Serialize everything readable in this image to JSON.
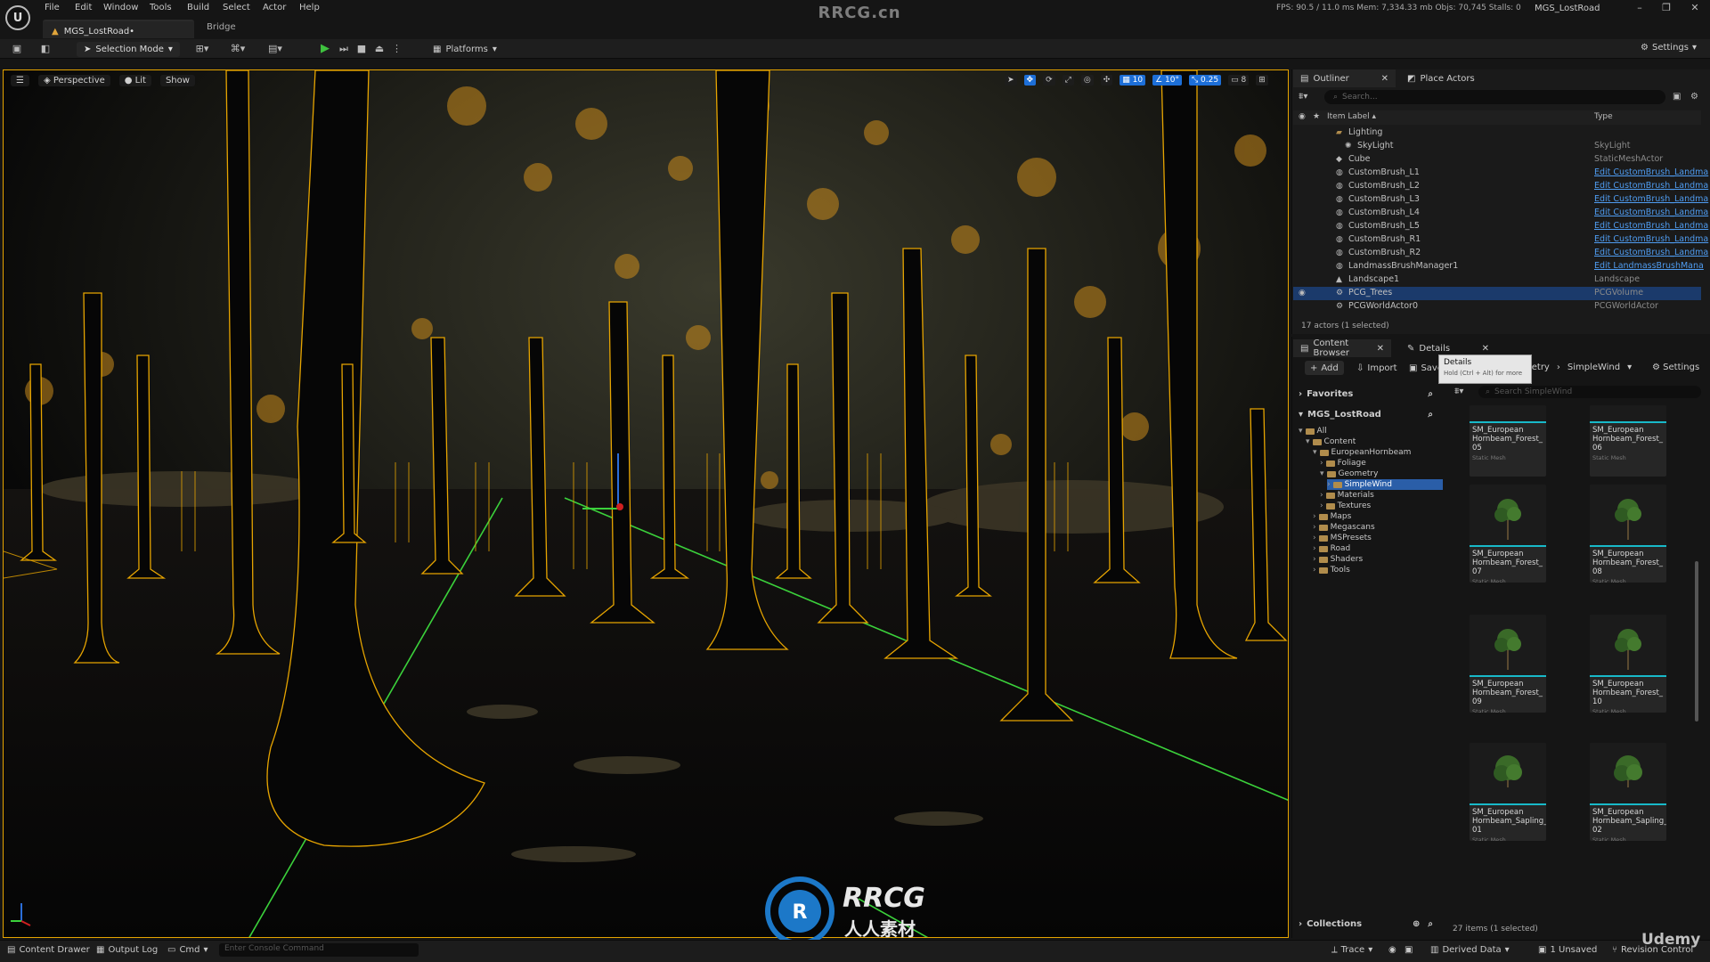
{
  "menu": [
    "File",
    "Edit",
    "Window",
    "Tools",
    "Build",
    "Select",
    "Actor",
    "Help"
  ],
  "window": {
    "center_title": "RRCG.cn",
    "stats": "FPS: 90.5  / 11.0 ms   Mem: 7,334.33 mb   Objs: 70,745   Stalls: 0",
    "project_name": "MGS_LostRoad"
  },
  "tabs": {
    "level": "MGS_LostRoad•",
    "bridge": "Bridge"
  },
  "toolbar": {
    "selection_mode": "Selection Mode",
    "platforms": "Platforms",
    "settings": "Settings"
  },
  "viewport": {
    "perspective": "Perspective",
    "lit": "Lit",
    "show": "Show",
    "grid_snap": "10",
    "rot_snap": "10°",
    "scale_snap": "0.25",
    "camera_speed": "8"
  },
  "outliner": {
    "tab": "Outliner",
    "place_actors_tab": "Place Actors",
    "search_placeholder": "Search...",
    "col_label": "Item Label ▴",
    "col_type": "Type",
    "rows": [
      {
        "label": "Lighting",
        "type": "",
        "link": false,
        "indent": 1,
        "icon": "folder"
      },
      {
        "label": "SkyLight",
        "type": "SkyLight",
        "link": false,
        "indent": 2,
        "icon": "light"
      },
      {
        "label": "Cube",
        "type": "StaticMeshActor",
        "link": false,
        "indent": 1,
        "icon": "mesh"
      },
      {
        "label": "CustomBrush_L1",
        "type": "Edit CustomBrush_Landma",
        "link": true,
        "indent": 1,
        "icon": "actor"
      },
      {
        "label": "CustomBrush_L2",
        "type": "Edit CustomBrush_Landma",
        "link": true,
        "indent": 1,
        "icon": "actor"
      },
      {
        "label": "CustomBrush_L3",
        "type": "Edit CustomBrush_Landma",
        "link": true,
        "indent": 1,
        "icon": "actor"
      },
      {
        "label": "CustomBrush_L4",
        "type": "Edit CustomBrush_Landma",
        "link": true,
        "indent": 1,
        "icon": "actor"
      },
      {
        "label": "CustomBrush_L5",
        "type": "Edit CustomBrush_Landma",
        "link": true,
        "indent": 1,
        "icon": "actor"
      },
      {
        "label": "CustomBrush_R1",
        "type": "Edit CustomBrush_Landma",
        "link": true,
        "indent": 1,
        "icon": "actor"
      },
      {
        "label": "CustomBrush_R2",
        "type": "Edit CustomBrush_Landma",
        "link": true,
        "indent": 1,
        "icon": "actor"
      },
      {
        "label": "LandmassBrushManager1",
        "type": "Edit LandmassBrushMana",
        "link": true,
        "indent": 1,
        "icon": "actor"
      },
      {
        "label": "Landscape1",
        "type": "Landscape",
        "link": false,
        "indent": 1,
        "icon": "landscape"
      },
      {
        "label": "PCG_Trees",
        "type": "PCGVolume",
        "link": false,
        "indent": 1,
        "icon": "pcg",
        "selected": true
      },
      {
        "label": "PCGWorldActor0",
        "type": "PCGWorldActor",
        "link": false,
        "indent": 1,
        "icon": "pcg"
      }
    ],
    "footer": "17 actors (1 selected)"
  },
  "content_browser": {
    "tab": "Content Browser",
    "details_tab": "Details",
    "tooltip_title": "Details",
    "tooltip_sub": "Hold (Ctrl + Alt) for more",
    "add": "Add",
    "import": "Import",
    "save": "Save",
    "breadcrumb": [
      "metry",
      "SimpleWind"
    ],
    "settings": "Settings",
    "favorites": "Favorites",
    "project": "MGS_LostRoad",
    "tree": [
      {
        "name": "All",
        "indent": 0,
        "open": true
      },
      {
        "name": "Content",
        "indent": 1,
        "open": true
      },
      {
        "name": "EuropeanHornbeam",
        "indent": 2,
        "open": true
      },
      {
        "name": "Foliage",
        "indent": 3,
        "open": false
      },
      {
        "name": "Geometry",
        "indent": 3,
        "open": true
      },
      {
        "name": "SimpleWind",
        "indent": 4,
        "open": false,
        "selected": true
      },
      {
        "name": "Materials",
        "indent": 3,
        "open": false
      },
      {
        "name": "Textures",
        "indent": 3,
        "open": false
      },
      {
        "name": "Maps",
        "indent": 2,
        "open": false
      },
      {
        "name": "Megascans",
        "indent": 2,
        "open": false
      },
      {
        "name": "MSPresets",
        "indent": 2,
        "open": false
      },
      {
        "name": "Road",
        "indent": 2,
        "open": false
      },
      {
        "name": "Shaders",
        "indent": 2,
        "open": false
      },
      {
        "name": "Tools",
        "indent": 2,
        "open": false
      }
    ],
    "search_placeholder": "Search SimpleWind",
    "assets": [
      {
        "name": "SM_European\nHornbeam_Forest_\n05",
        "kind": "Static Mesh",
        "thumb": "none"
      },
      {
        "name": "SM_European\nHornbeam_Forest_\n06",
        "kind": "Static Mesh",
        "thumb": "none"
      },
      {
        "name": "SM_European\nHornbeam_Forest_\n07",
        "kind": "Static Mesh",
        "thumb": "tree"
      },
      {
        "name": "SM_European\nHornbeam_Forest_\n08",
        "kind": "Static Mesh",
        "thumb": "tree"
      },
      {
        "name": "SM_European\nHornbeam_Forest_\n09",
        "kind": "Static Mesh",
        "thumb": "tree"
      },
      {
        "name": "SM_European\nHornbeam_Forest_\n10",
        "kind": "Static Mesh",
        "thumb": "tree"
      },
      {
        "name": "SM_European\nHornbeam_Sapling_\n01",
        "kind": "Static Mesh",
        "thumb": "sapling"
      },
      {
        "name": "SM_European\nHornbeam_Sapling_\n02",
        "kind": "Static Mesh",
        "thumb": "sapling"
      }
    ],
    "collections": "Collections",
    "count": "27 items (1 selected)"
  },
  "statusbar": {
    "content_drawer": "Content Drawer",
    "output_log": "Output Log",
    "cmd": "Cmd",
    "console_placeholder": "Enter Console Command",
    "trace": "Trace",
    "derived_data": "Derived Data",
    "unsaved": "1 Unsaved",
    "revision": "Revision Control"
  },
  "watermark": {
    "logo_text": "RRCG",
    "logo_sub": "人人素材",
    "udemy": "Udemy"
  },
  "colors": {
    "selection_outline": "#e6a400",
    "accent_blue": "#1d6fd8",
    "asset_bar": "#18b9c9",
    "play_green": "#3fc23f"
  }
}
